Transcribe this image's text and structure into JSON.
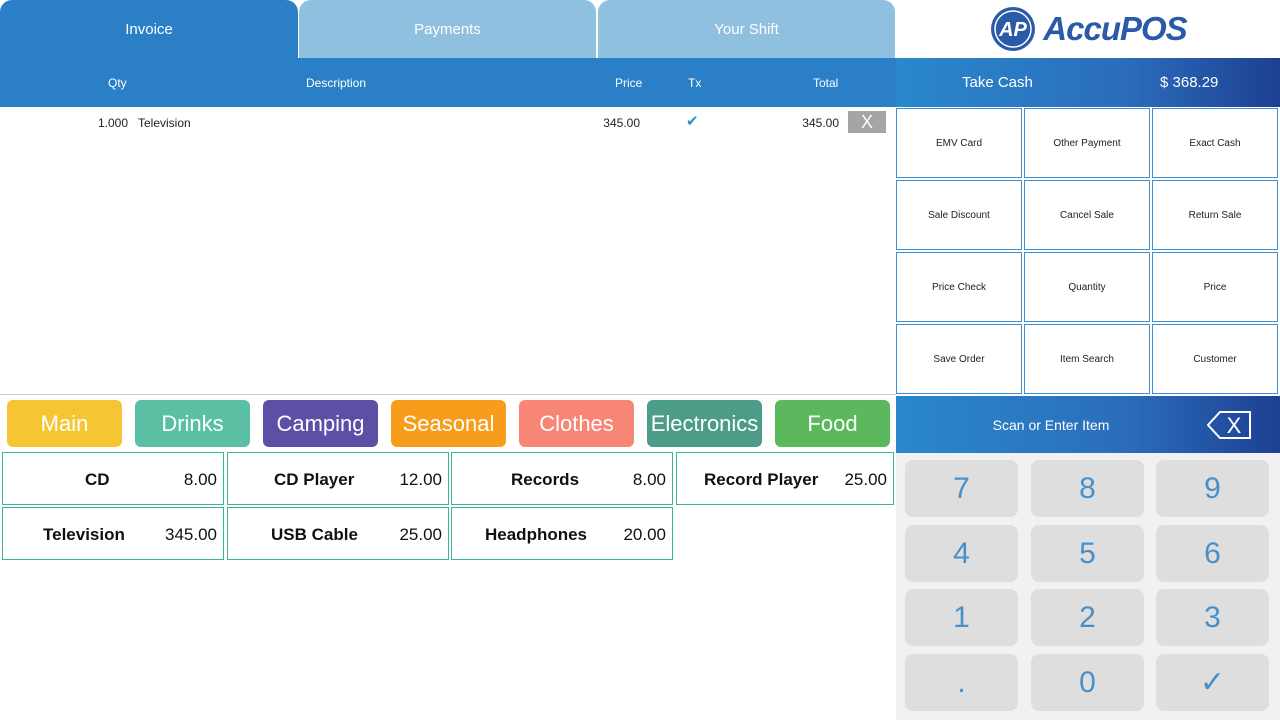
{
  "tabs": [
    {
      "label": "Invoice",
      "active": true
    },
    {
      "label": "Payments",
      "active": false
    },
    {
      "label": "Your Shift",
      "active": false
    }
  ],
  "brand": {
    "logo_text": "AccuPOS",
    "logo_initials": "AP",
    "color": "#2a5aa8"
  },
  "invoice": {
    "columns": {
      "qty": "Qty",
      "description": "Description",
      "price": "Price",
      "tx": "Tx",
      "total": "Total"
    },
    "rows": [
      {
        "qty": "1.000",
        "description": "Television",
        "price": "345.00",
        "taxed": true,
        "total": "345.00",
        "delete_label": "X"
      }
    ]
  },
  "take_cash": {
    "label": "Take Cash",
    "amount": "$ 368.29"
  },
  "functions": [
    "EMV Card",
    "Other Payment",
    "Exact Cash",
    "Sale Discount",
    "Cancel Sale",
    "Return Sale",
    "Price Check",
    "Quantity",
    "Price",
    "Save Order",
    "Item Search",
    "Customer"
  ],
  "categories": [
    {
      "label": "Main",
      "color": "#f6c533"
    },
    {
      "label": "Drinks",
      "color": "#5bbfa4"
    },
    {
      "label": "Camping",
      "color": "#5c4fa6"
    },
    {
      "label": "Seasonal",
      "color": "#f89c1c"
    },
    {
      "label": "Clothes",
      "color": "#f88677"
    },
    {
      "label": "Electronics",
      "color": "#4c9c88"
    },
    {
      "label": "Food",
      "color": "#5cb85c"
    }
  ],
  "items": [
    {
      "name": "CD",
      "price": "8.00"
    },
    {
      "name": "CD Player",
      "price": "12.00"
    },
    {
      "name": "Records",
      "price": "8.00"
    },
    {
      "name": "Record Player",
      "price": "25.00"
    },
    {
      "name": "Television",
      "price": "345.00"
    },
    {
      "name": "USB Cable",
      "price": "25.00"
    },
    {
      "name": "Headphones",
      "price": "20.00"
    }
  ],
  "scan": {
    "placeholder": "Scan or Enter Item",
    "clear_label": "X"
  },
  "keypad": [
    "7",
    "8",
    "9",
    "4",
    "5",
    "6",
    "1",
    "2",
    "3",
    ".",
    "0",
    "✓"
  ]
}
